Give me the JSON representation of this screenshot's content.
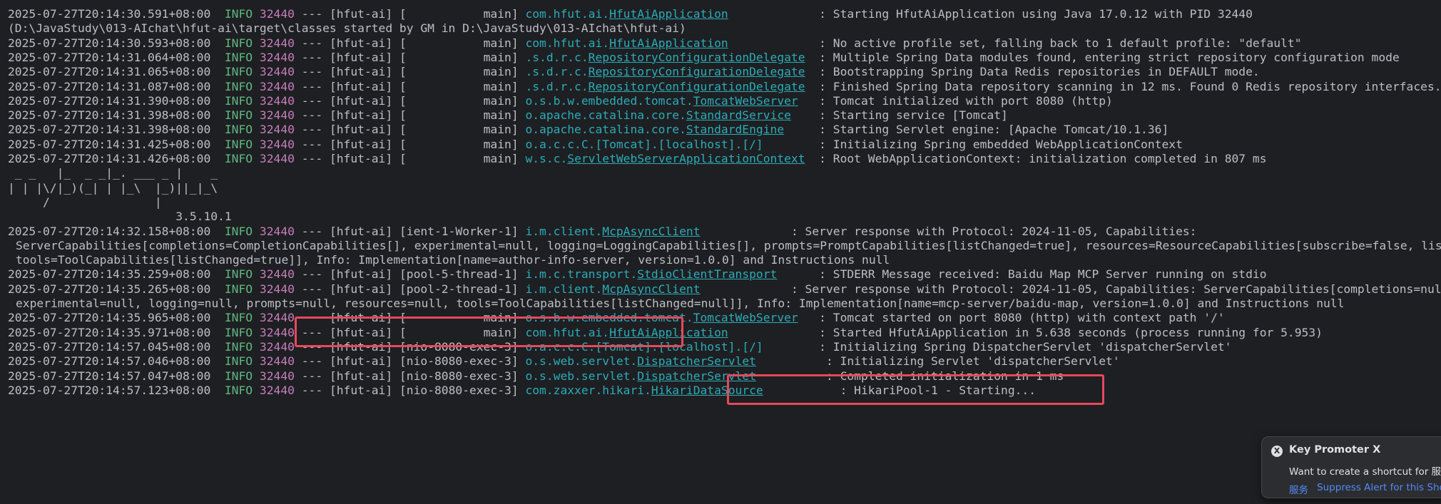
{
  "log_lines": [
    {
      "ts": "2025-07-27T20:14:30.591+08:00",
      "lvl": "INFO",
      "pid": "32440",
      "app": "--- [hfut-ai] [",
      "th": "           main]",
      "lp": "com.hfut.ai.",
      "lu": "HfutAiApplication",
      "lpad": "            ",
      "msg": ": Starting HfutAiApplication using Java 17.0.12 with PID 32440"
    },
    {
      "raw": "(D:\\JavaStudy\\013-AIchat\\hfut-ai\\target\\classes started by GM in D:\\JavaStudy\\013-AIchat\\hfut-ai)"
    },
    {
      "ts": "2025-07-27T20:14:30.593+08:00",
      "lvl": "INFO",
      "pid": "32440",
      "app": "--- [hfut-ai] [",
      "th": "           main]",
      "lp": "com.hfut.ai.",
      "lu": "HfutAiApplication",
      "lpad": "            ",
      "msg": ": No active profile set, falling back to 1 default profile: \"default\""
    },
    {
      "ts": "2025-07-27T20:14:31.064+08:00",
      "lvl": "INFO",
      "pid": "32440",
      "app": "--- [hfut-ai] [",
      "th": "           main]",
      "lp": ".s.d.r.c.",
      "lu": "RepositoryConfigurationDelegate",
      "lpad": " ",
      "msg": ": Multiple Spring Data modules found, entering strict repository configuration mode"
    },
    {
      "ts": "2025-07-27T20:14:31.065+08:00",
      "lvl": "INFO",
      "pid": "32440",
      "app": "--- [hfut-ai] [",
      "th": "           main]",
      "lp": ".s.d.r.c.",
      "lu": "RepositoryConfigurationDelegate",
      "lpad": " ",
      "msg": ": Bootstrapping Spring Data Redis repositories in DEFAULT mode."
    },
    {
      "ts": "2025-07-27T20:14:31.087+08:00",
      "lvl": "INFO",
      "pid": "32440",
      "app": "--- [hfut-ai] [",
      "th": "           main]",
      "lp": ".s.d.r.c.",
      "lu": "RepositoryConfigurationDelegate",
      "lpad": " ",
      "msg": ": Finished Spring Data repository scanning in 12 ms. Found 0 Redis repository interfaces."
    },
    {
      "ts": "2025-07-27T20:14:31.390+08:00",
      "lvl": "INFO",
      "pid": "32440",
      "app": "--- [hfut-ai] [",
      "th": "           main]",
      "lp": "o.s.b.w.embedded.tomcat.",
      "lu": "TomcatWebServer",
      "lpad": "  ",
      "msg": ": Tomcat initialized with port 8080 (http)"
    },
    {
      "ts": "2025-07-27T20:14:31.398+08:00",
      "lvl": "INFO",
      "pid": "32440",
      "app": "--- [hfut-ai] [",
      "th": "           main]",
      "lp": "o.apache.catalina.core.",
      "lu": "StandardService",
      "lpad": "   ",
      "msg": ": Starting service [Tomcat]"
    },
    {
      "ts": "2025-07-27T20:14:31.398+08:00",
      "lvl": "INFO",
      "pid": "32440",
      "app": "--- [hfut-ai] [",
      "th": "           main]",
      "lp": "o.apache.catalina.core.",
      "lu": "StandardEngine",
      "lpad": "    ",
      "msg": ": Starting Servlet engine: [Apache Tomcat/10.1.36]"
    },
    {
      "ts": "2025-07-27T20:14:31.425+08:00",
      "lvl": "INFO",
      "pid": "32440",
      "app": "--- [hfut-ai] [",
      "th": "           main]",
      "lp": "o.a.c.c.C.[Tomcat].[localhost].[/]",
      "lu": "",
      "lpad": "       ",
      "msg": ": Initializing Spring embedded WebApplicationContext"
    },
    {
      "ts": "2025-07-27T20:14:31.426+08:00",
      "lvl": "INFO",
      "pid": "32440",
      "app": "--- [hfut-ai] [",
      "th": "           main]",
      "lp": "w.s.c.",
      "lu": "ServletWebServerApplicationContext",
      "lpad": " ",
      "msg": ": Root WebApplicationContext: initialization completed in 807 ms"
    },
    {
      "raw": " _ _   |_  _ _|_. ___ _ |    _"
    },
    {
      "raw": "| | |\\/|_)(_| | |_\\  |_)||_|_\\"
    },
    {
      "raw": "     /               |"
    },
    {
      "raw": "                        3.5.10.1"
    },
    {
      "ts": "2025-07-27T20:14:32.158+08:00",
      "lvl": "INFO",
      "pid": "32440",
      "app": "--- [hfut-ai] [",
      "th": "ient-1-Worker-1]",
      "lp": "i.m.client.",
      "lu": "McpAsyncClient",
      "lpad": "            ",
      "msg": ": Server response with Protocol: 2024-11-05, Capabilities:"
    },
    {
      "cont": true,
      "raw": "ServerCapabilities[completions=CompletionCapabilities[], experimental=null, logging=LoggingCapabilities[], prompts=PromptCapabilities[listChanged=true], resources=ResourceCapabilities[subscribe=false, listChanged=true],"
    },
    {
      "cont": true,
      "raw": "tools=ToolCapabilities[listChanged=true]], Info: Implementation[name=author-info-server, version=1.0.0] and Instructions null"
    },
    {
      "ts": "2025-07-27T20:14:35.259+08:00",
      "lvl": "INFO",
      "pid": "32440",
      "app": "--- [hfut-ai] [",
      "th": "pool-5-thread-1]",
      "lp": "i.m.c.transport.",
      "lu": "StdioClientTransport",
      "lpad": "     ",
      "msg": ": STDERR Message received: Baidu Map MCP Server running on stdio"
    },
    {
      "ts": "2025-07-27T20:14:35.265+08:00",
      "lvl": "INFO",
      "pid": "32440",
      "app": "--- [hfut-ai] [",
      "th": "pool-2-thread-1]",
      "lp": "i.m.client.",
      "lu": "McpAsyncClient",
      "lpad": "            ",
      "msg": ": Server response with Protocol: 2024-11-05, Capabilities: ServerCapabilities[completions=null,"
    },
    {
      "cont": true,
      "raw": "experimental=null, logging=null, prompts=null, resources=null, tools=ToolCapabilities[listChanged=null]], Info: Implementation[name=mcp-server/baidu-map, version=1.0.0] and Instructions null"
    },
    {
      "ts": "2025-07-27T20:14:35.965+08:00",
      "lvl": "INFO",
      "pid": "32440",
      "app": "--- [hfut-ai] [",
      "th": "           main]",
      "lp": "o.s.b.w.embedded.tomcat.",
      "lu": "TomcatWebServer",
      "lpad": "  ",
      "msg": ": Tomcat started on port 8080 (http) with context path '/'"
    },
    {
      "ts": "2025-07-27T20:14:35.971+08:00",
      "lvl": "INFO",
      "pid": "32440",
      "app": "--- [hfut-ai] [",
      "th": "           main]",
      "lp": "com.hfut.ai.",
      "lu": "HfutAiApplication",
      "lpad": "            ",
      "msg": ": Started HfutAiApplication in 5.638 seconds (process running for 5.953)"
    },
    {
      "ts": "2025-07-27T20:14:57.045+08:00",
      "lvl": "INFO",
      "pid": "32440",
      "app": "--- [hfut-ai] [",
      "th": "nio-8080-exec-3]",
      "lp": "o.a.c.c.C.[Tomcat].[localhost].[/]",
      "lu": "",
      "lpad": "       ",
      "msg": ": Initializing Spring DispatcherServlet 'dispatcherServlet'"
    },
    {
      "ts": "2025-07-27T20:14:57.046+08:00",
      "lvl": "INFO",
      "pid": "32440",
      "app": "--- [hfut-ai] [",
      "th": "nio-8080-exec-3]",
      "lp": "o.s.web.servlet.",
      "lu": "DispatcherServlet",
      "lpad": "         ",
      "msg": ": Initializing Servlet 'dispatcherServlet'"
    },
    {
      "ts": "2025-07-27T20:14:57.047+08:00",
      "lvl": "INFO",
      "pid": "32440",
      "app": "--- [hfut-ai] [",
      "th": "nio-8080-exec-3]",
      "lp": "o.s.web.servlet.",
      "lu": "DispatcherServlet",
      "lpad": "         ",
      "msg": ": Completed initialization in 1 ms"
    },
    {
      "ts": "2025-07-27T20:14:57.123+08:00",
      "lvl": "INFO",
      "pid": "32440",
      "app": "--- [hfut-ai] [",
      "th": "nio-8080-exec-3]",
      "lp": "com.zaxxer.hikari.",
      "lu": "HikariDataSource",
      "lpad": "          ",
      "msg": ": HikariPool-1 - Starting..."
    }
  ],
  "highlight_color": "#e8485b",
  "popup": {
    "icon": "key-promoter-icon",
    "title": "Key Promoter X",
    "body": "Want to create a shortcut for 服务?",
    "action_primary": "服务",
    "action_secondary": "Suppress Alert for this Shortcut"
  }
}
